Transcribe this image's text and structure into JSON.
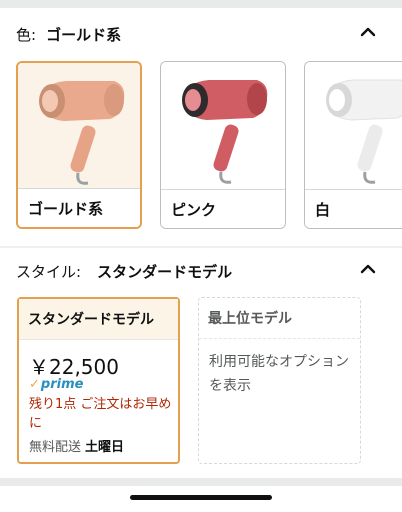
{
  "color_section": {
    "label": "色:",
    "selected_value": "ゴールド系"
  },
  "color_options": [
    {
      "name": "ゴールド系",
      "body_color": "#e8a98c",
      "accent_color": "#c98f73",
      "selected": true
    },
    {
      "name": "ピンク",
      "body_color": "#cf5d63",
      "accent_color": "#b2444c",
      "selected": false
    },
    {
      "name": "白",
      "body_color": "#f3f2f2",
      "accent_color": "#d9d8d8",
      "selected": false
    }
  ],
  "style_section": {
    "label": "スタイル:",
    "selected_value": "スタンダードモデル"
  },
  "style_options": {
    "selected": {
      "title": "スタンダードモデル",
      "price": "￥22,500",
      "prime_label": "prime",
      "stock_note": "残り1点 ご注文はお早めに",
      "shipping_label": "無料配送",
      "shipping_day": "土曜日"
    },
    "unavailable": {
      "title": "最上位モデル",
      "message": "利用可能なオプションを表示"
    }
  },
  "colors": {
    "accent": "#e3a04e",
    "prime_blue": "#2a8ebf",
    "stock_red": "#b12704"
  },
  "icons": [
    "chevron-up-icon",
    "prime-check-icon"
  ]
}
